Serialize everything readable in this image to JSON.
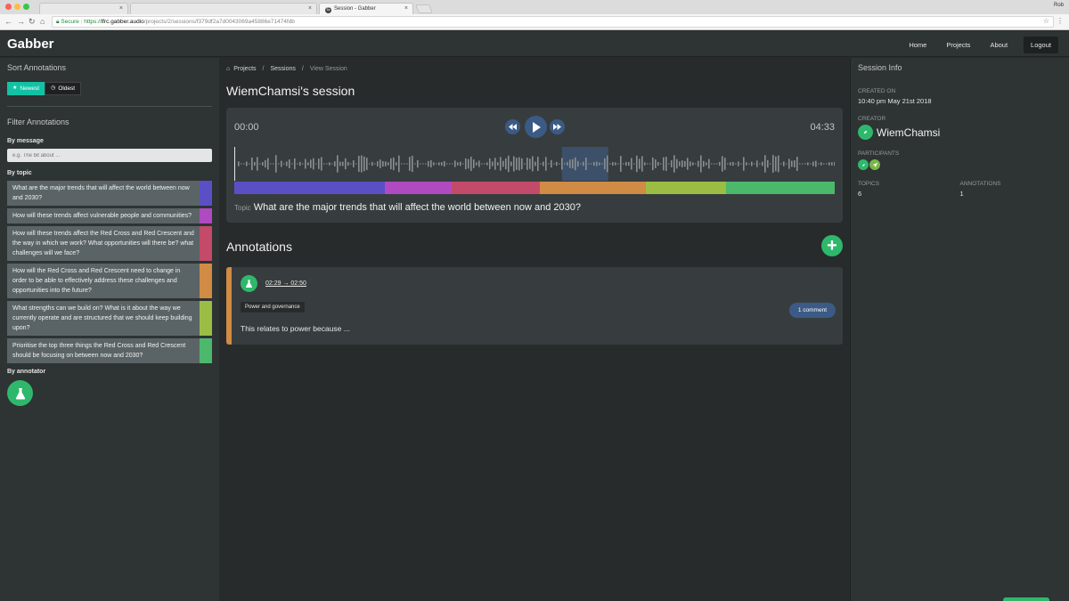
{
  "browser": {
    "tabs": [
      {
        "label": ""
      },
      {
        "label": ""
      },
      {
        "label": "Session - Gabber",
        "active": true
      }
    ],
    "profile": "Rob",
    "url": {
      "secure_label": "Secure",
      "scheme": "https://",
      "host": "lfrc.gabber.audio",
      "path": "/projects/2/sessions/f379df2a7d0043069a45886e71474fdb"
    }
  },
  "header": {
    "brand": "Gabber",
    "nav": [
      "Home",
      "Projects",
      "About"
    ],
    "logout": "Logout"
  },
  "left": {
    "sort_title": "Sort Annotations",
    "sort_newest": "Newest",
    "sort_oldest": "Oldest",
    "filter_title": "Filter Annotations",
    "by_message": "By message",
    "message_placeholder": "e.g. The bit about ...",
    "by_topic": "By topic",
    "topics": [
      {
        "text": "What are the major trends that will affect the world between now and 2030?",
        "color": "#5b4fc6"
      },
      {
        "text": "How will these trends affect vulnerable people and communities?",
        "color": "#b04ac0"
      },
      {
        "text": "How will these trends affect the Red Cross and Red Crescent and the way in which we work? What opportunities will there be? what challenges will we face?",
        "color": "#c44a69"
      },
      {
        "text": "How will the Red Cross and Red Crescent need to change in order to be able to effectively address these challenges and opportunities into the future?",
        "color": "#d08b45"
      },
      {
        "text": "What strengths can we build on? What is it about the way we currently operate and are structured that we should keep building upon?",
        "color": "#9cbd44"
      },
      {
        "text": "Prioritise the top three things the Red Cross and Red Crescent should be focusing on between now and 2030?",
        "color": "#4cb86c"
      }
    ],
    "by_annotator": "By annotator"
  },
  "main": {
    "breadcrumb": [
      "Projects",
      "Sessions",
      "View Session"
    ],
    "session_title": "WiemChamsi's session",
    "player": {
      "current_time": "00:00",
      "duration": "04:33",
      "progress": 0,
      "topic_label": "Topic",
      "current_topic": "What are the major trends that will affect the world between now and 2030?",
      "topic_segments": [
        {
          "fraction": 0.251,
          "color": "#5b4fc6"
        },
        {
          "fraction": 0.111,
          "color": "#b04ac0"
        },
        {
          "fraction": 0.147,
          "color": "#c44a69"
        },
        {
          "fraction": 0.176,
          "color": "#d08b45"
        },
        {
          "fraction": 0.134,
          "color": "#9cbd44"
        },
        {
          "fraction": 0.181,
          "color": "#4cb86c"
        }
      ],
      "highlight_start": "02:29",
      "highlight_end": "02:50"
    },
    "annotations_title": "Annotations",
    "annotations": [
      {
        "range": "02:29 → 02:50",
        "tag": "Power and governance",
        "comments": "1 comment",
        "text": "This relates to power because ...",
        "accent": "#d08b45"
      }
    ]
  },
  "right": {
    "title": "Session Info",
    "created_label": "Created On",
    "created_value": "10:40 pm May 21st 2018",
    "creator_label": "Creator",
    "creator_name": "WiemChamsi",
    "participants_label": "Participants",
    "topics_label": "Topics",
    "topics_value": "6",
    "annotations_label": "Annotations",
    "annotations_value": "1"
  },
  "colors": {
    "accent_green": "#2fb86c",
    "button_blue": "#3b5a85",
    "sort_active": "#12c2a4"
  }
}
